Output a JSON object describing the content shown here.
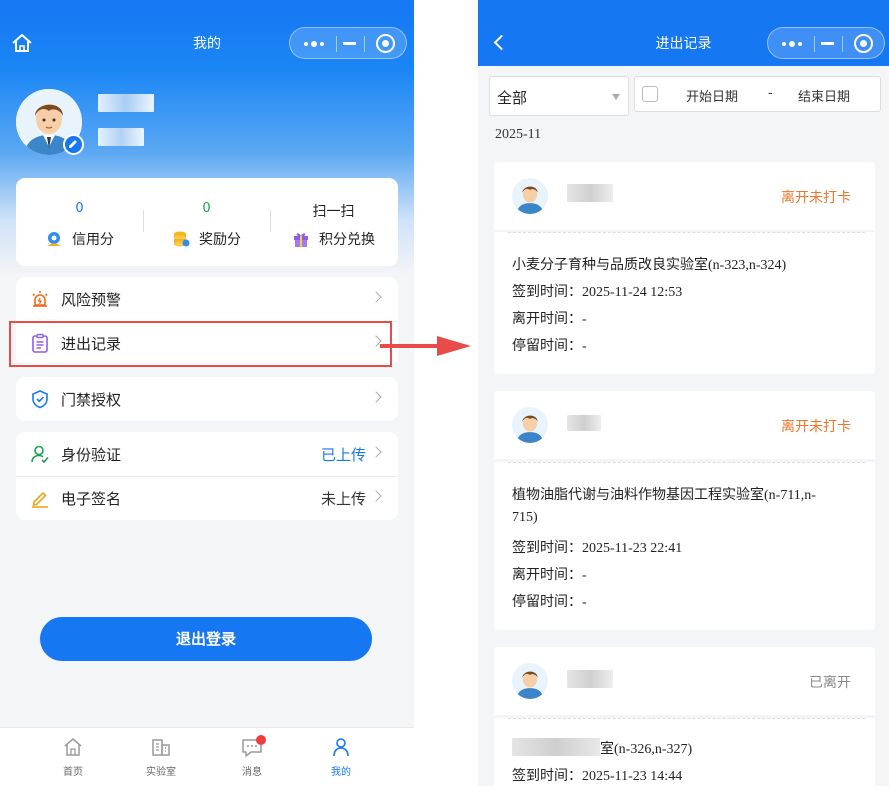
{
  "left_phone": {
    "header": {
      "title": "我的"
    },
    "stats": [
      {
        "value": "0",
        "label": "信用分",
        "value_color": "#1677f3"
      },
      {
        "value": "0",
        "label": "奖励分",
        "value_color": "#1aa34a"
      },
      {
        "value": "扫一扫",
        "label": "积分兑换",
        "value_color": "#222222"
      }
    ],
    "menu": {
      "risk_warning": "风险预警",
      "access_records": "进出记录",
      "door_auth": "门禁授权",
      "identity": {
        "label": "身份验证",
        "value": "已上传",
        "value_color": "#1677f3"
      },
      "e_signature": {
        "label": "电子签名",
        "value": "未上传",
        "value_color": "#333333"
      }
    },
    "logout_label": "退出登录",
    "tabs": [
      {
        "label": "首页"
      },
      {
        "label": "实验室"
      },
      {
        "label": "消息"
      },
      {
        "label": "我的"
      }
    ]
  },
  "right_phone": {
    "header": {
      "title": "进出记录"
    },
    "filter": {
      "selected": "全部",
      "start_date": "开始日期",
      "separator": "-",
      "end_date": "结束日期"
    },
    "month": "2025-11",
    "records": [
      {
        "status": "离开未打卡",
        "status_color": "#f0762b",
        "lab": "小麦分子育种与品质改良实验室(n-323,n-324)",
        "lab_cont": "",
        "checkin_label": "签到时间：",
        "checkin": "2025-11-24 12:53",
        "leave_label": "离开时间：",
        "leave": "-",
        "stay_label": "停留时间：",
        "stay": "-"
      },
      {
        "status": "离开未打卡",
        "status_color": "#f0762b",
        "lab": "植物油脂代谢与油料作物基因工程实验室(n-711,n-",
        "lab_cont": "715)",
        "checkin_label": "签到时间：",
        "checkin": "2025-11-23 22:41",
        "leave_label": "离开时间：",
        "leave": "-",
        "stay_label": "停留时间：",
        "stay": "-"
      },
      {
        "status": "已离开",
        "status_color": "#888888",
        "lab": "室(n-326,n-327)",
        "lab_cont": "",
        "checkin_label": "签到时间：",
        "checkin": "2025-11-23 14:44",
        "leave_label": "",
        "leave": "",
        "stay_label": "",
        "stay": ""
      }
    ]
  }
}
